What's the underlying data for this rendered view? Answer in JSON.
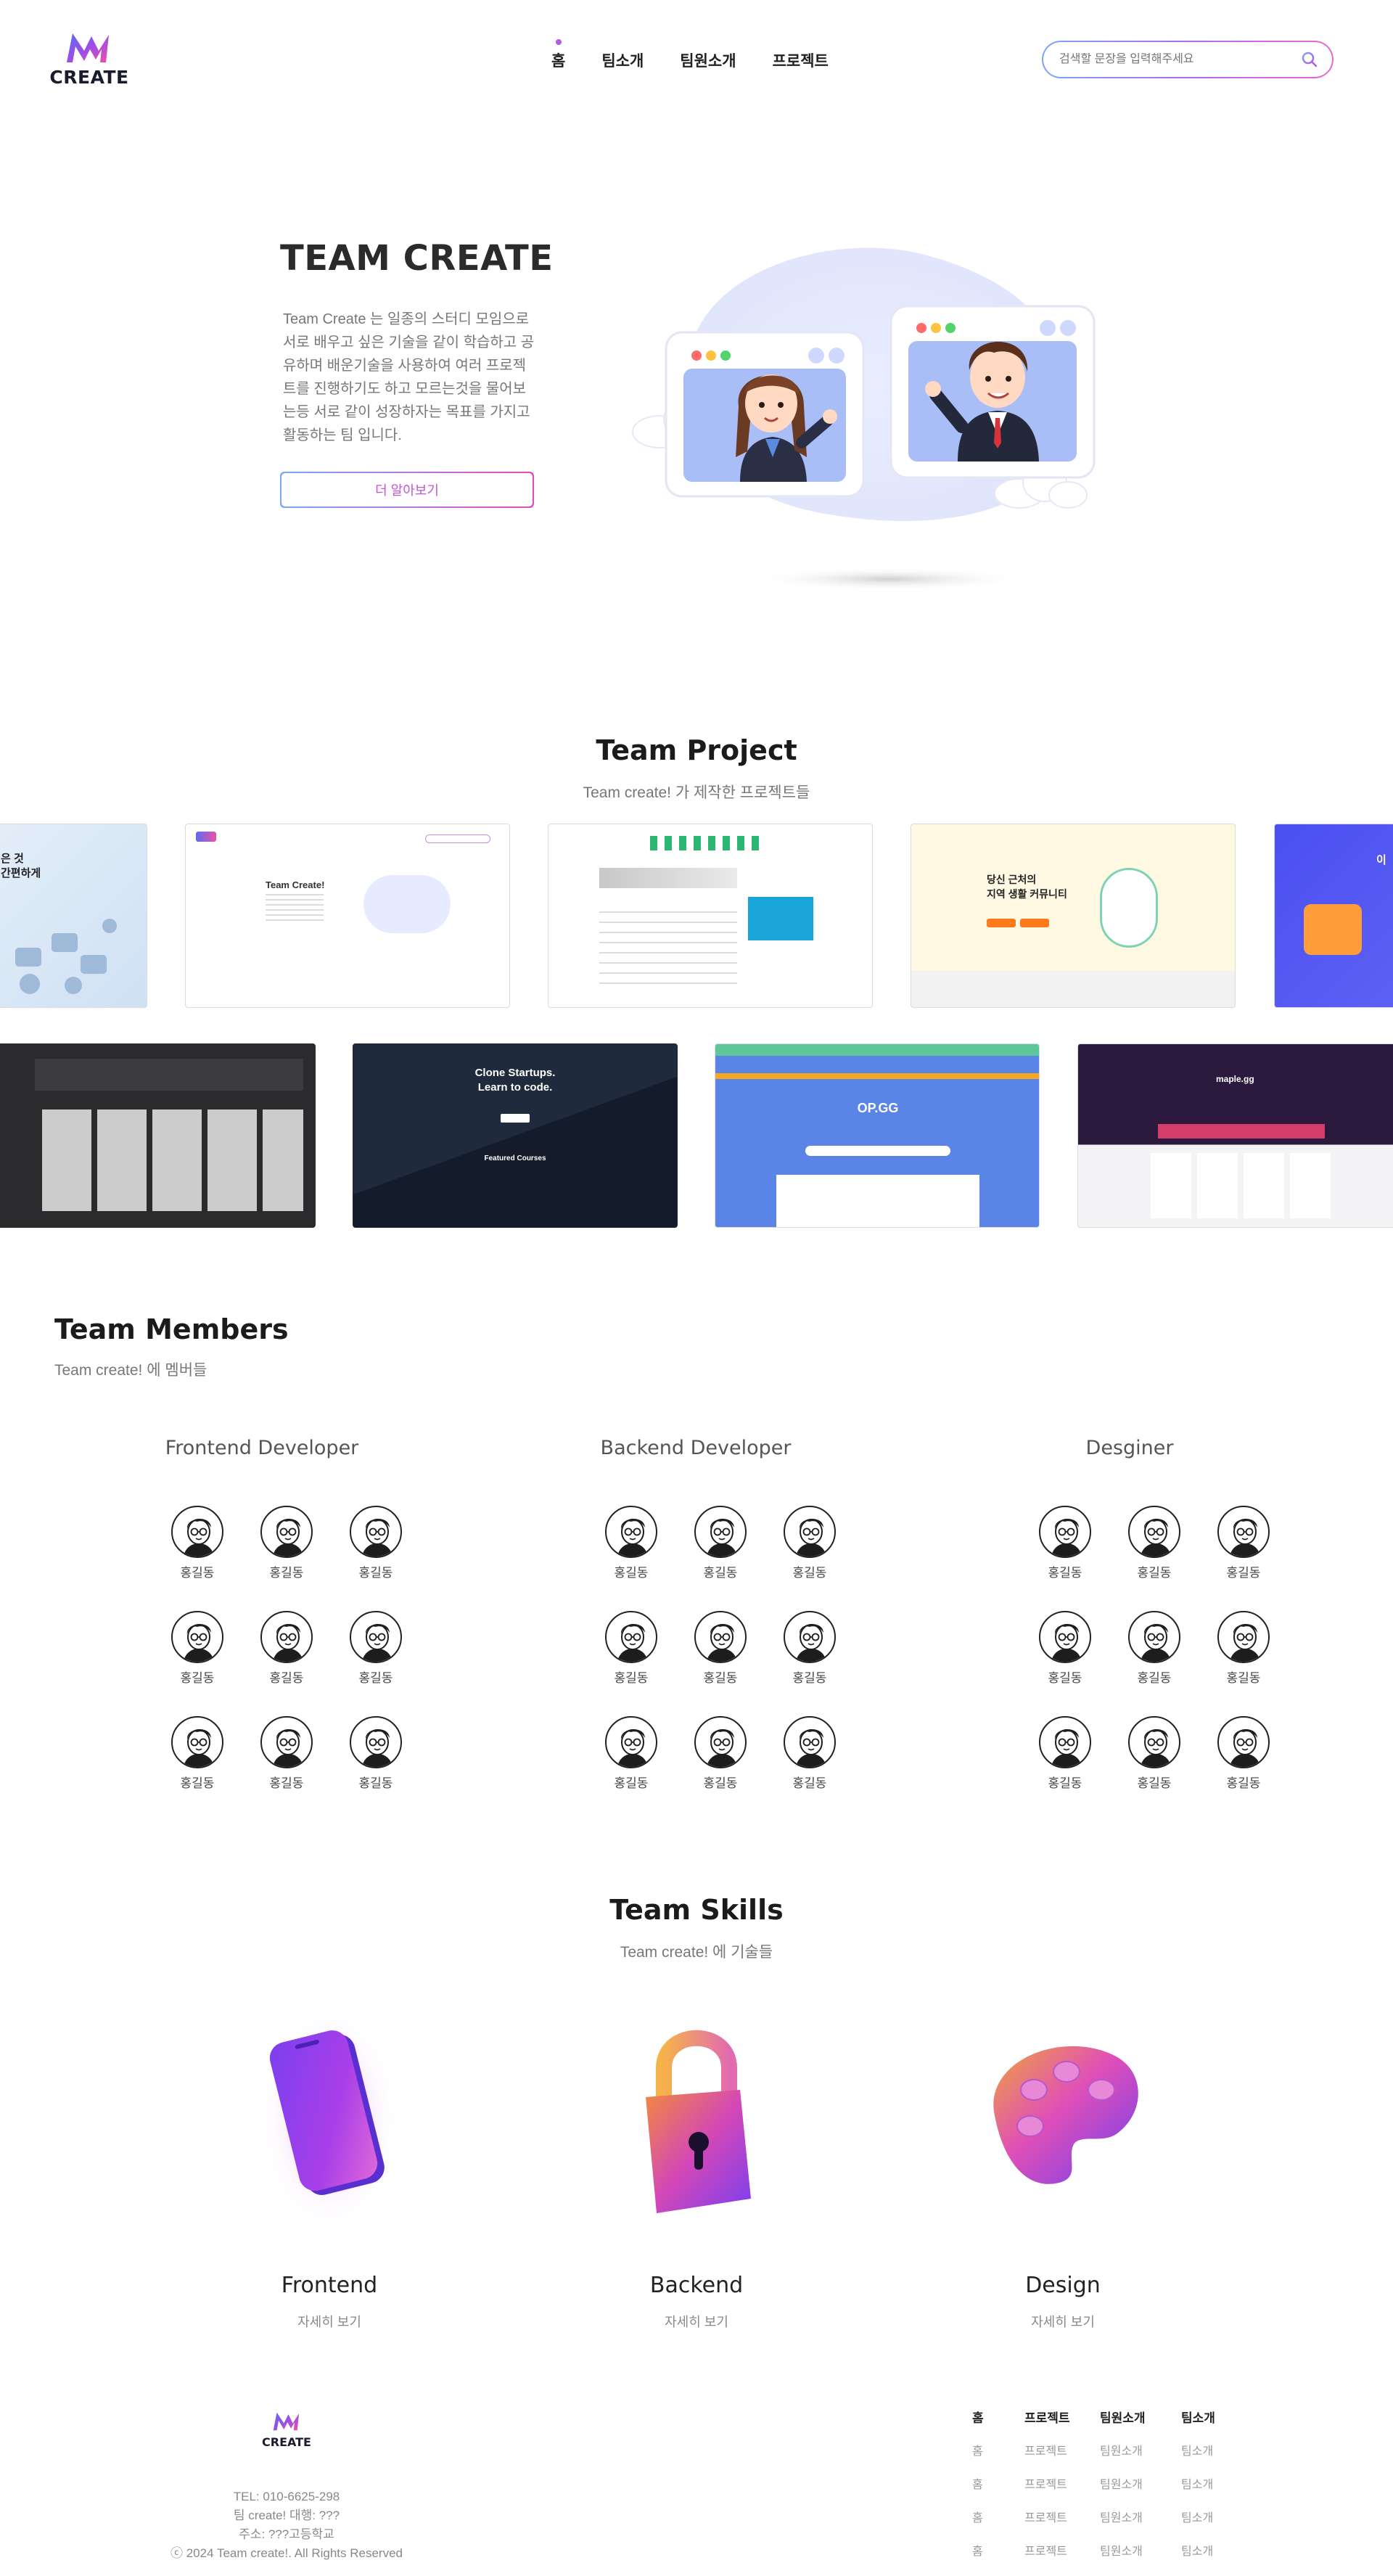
{
  "header": {
    "logo_text": "CREATE",
    "nav": [
      "홈",
      "팀소개",
      "팀원소개",
      "프로젝트"
    ],
    "active_nav": "홈",
    "search_placeholder": "검색할 문장을 입력해주세요"
  },
  "hero": {
    "title": "TEAM CREATE",
    "description": "Team Create 는 일종의 스터디 모임으로 서로 배우고 싶은 기술을 같이 학습하고 공유하며 배운기술을 사용하여 여러 프로젝트를 진행하기도 하고 모르는것을 물어보는등 서로 같이 성장하자는 목표를 가지고 활동하는 팀 입니다.",
    "button": "더 알아보기"
  },
  "projects": {
    "title": "Team Project",
    "subtitle": "Team create! 가 제작한 프로젝트들",
    "row1_texts": {
      "card1": "은 것\n간편하게",
      "card2": "Team Create!",
      "card4": "당신 근처의\n지역 생활 커뮤니티",
      "card5": "이"
    },
    "row2_texts": {
      "card2_title": "Clone Startups.\nLearn to code.",
      "card2_sub": "Featured Courses",
      "card4_brand": "maple.gg",
      "card3_brand": "OP.GG"
    }
  },
  "members": {
    "title": "Team Members",
    "subtitle": "Team create! 에 멤버들",
    "groups": [
      {
        "role": "Frontend Developer",
        "names": [
          "홍길동",
          "홍길동",
          "홍길동",
          "홍길동",
          "홍길동",
          "홍길동",
          "홍길동",
          "홍길동",
          "홍길동"
        ]
      },
      {
        "role": "Backend Developer",
        "names": [
          "홍길동",
          "홍길동",
          "홍길동",
          "홍길동",
          "홍길동",
          "홍길동",
          "홍길동",
          "홍길동",
          "홍길동"
        ]
      },
      {
        "role": "Desginer",
        "names": [
          "홍길동",
          "홍길동",
          "홍길동",
          "홍길동",
          "홍길동",
          "홍길동",
          "홍길동",
          "홍길동",
          "홍길동"
        ]
      }
    ]
  },
  "skills": {
    "title": "Team Skills",
    "subtitle": "Team create! 에 기술들",
    "items": [
      {
        "name": "Frontend",
        "link": "자세히 보기",
        "icon": "phone-3d-icon"
      },
      {
        "name": "Backend",
        "link": "자세히 보기",
        "icon": "lock-3d-icon"
      },
      {
        "name": "Design",
        "link": "자세히 보기",
        "icon": "palette-3d-icon"
      }
    ]
  },
  "footer": {
    "logo_text": "CREATE",
    "info": [
      "TEL: 010-6625-298",
      "팀 create! 대행: ???",
      "주소: ???고등학교",
      "ⓒ 2024 Team create!. All Rights Reserved"
    ],
    "columns": [
      {
        "head": "홈",
        "links": [
          "홈",
          "홈",
          "홈",
          "홈"
        ]
      },
      {
        "head": "프로젝트",
        "links": [
          "프로젝트",
          "프로젝트",
          "프로젝트",
          "프로젝트"
        ]
      },
      {
        "head": "팀원소개",
        "links": [
          "팀원소개",
          "팀원소개",
          "팀원소개",
          "팀원소개"
        ]
      },
      {
        "head": "팀소개",
        "links": [
          "팀소개",
          "팀소개",
          "팀소개",
          "팀소개"
        ]
      }
    ]
  },
  "colors": {
    "accent_purple": "#b25be0",
    "accent_blue": "#7aa7f7",
    "accent_pink": "#e44bb8"
  }
}
